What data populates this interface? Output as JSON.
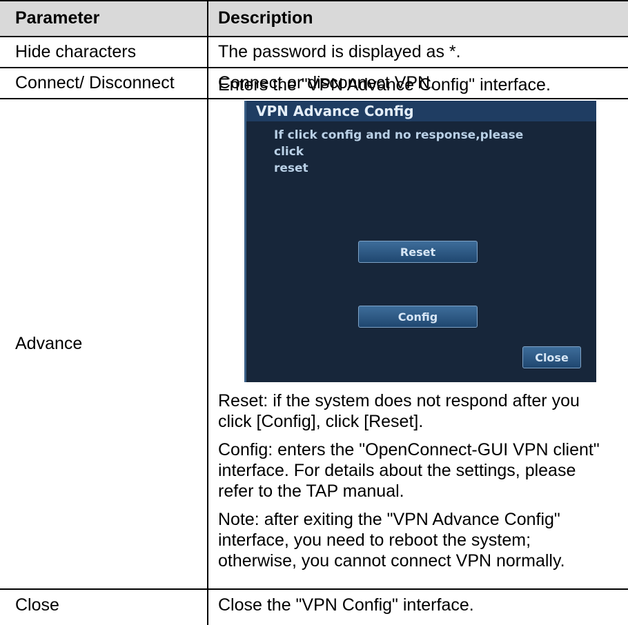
{
  "table": {
    "headers": [
      "Parameter",
      "Description"
    ],
    "rows": [
      {
        "param": "Hide characters",
        "desc": "The password is displayed as *."
      },
      {
        "param": "Connect/ Disconnect",
        "desc": "Connect or disconnect VPN."
      },
      {
        "param": "Advance",
        "desc_intro": "Enters the \"VPN Advance Config\" interface.",
        "desc_reset_1": "Reset: if the system does not respond after you",
        "desc_reset_2": "click [Config], click [Reset].",
        "desc_config_1": "Config: enters the \"OpenConnect-GUI VPN client\"",
        "desc_config_2": "interface. For details about the settings, please",
        "desc_config_3": "refer to the TAP manual.",
        "desc_note_1": "Note: after exiting the \"VPN Advance Config\"",
        "desc_note_2": "interface, you need to reboot the system;",
        "desc_note_3": "otherwise, you cannot connect VPN normally."
      },
      {
        "param": "Close",
        "desc": "Close the \"VPN Config\" interface."
      }
    ]
  },
  "dialog": {
    "title": "VPN Advance Config",
    "message_1": "If click config and no response,please click",
    "message_2": "reset",
    "reset_label": "Reset",
    "config_label": "Config",
    "close_label": "Close"
  }
}
